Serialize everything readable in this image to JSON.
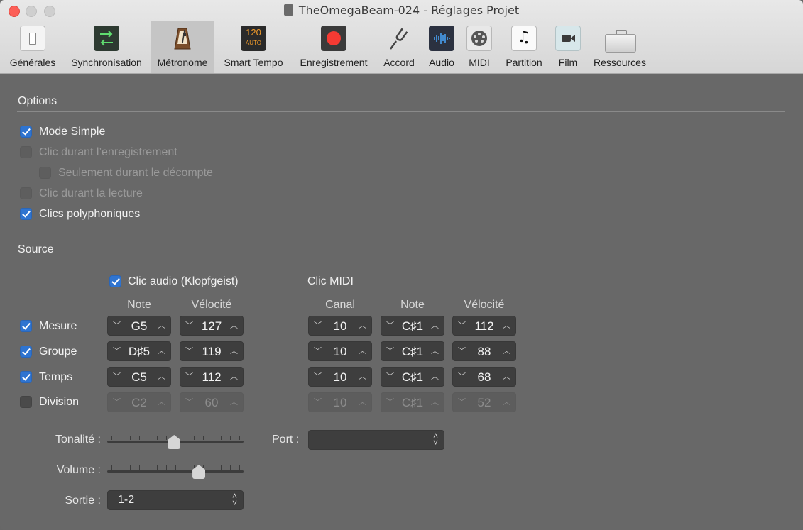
{
  "window": {
    "title": "TheOmegaBeam-024 - Réglages Projet"
  },
  "toolbar": {
    "items": [
      {
        "label": "Générales",
        "icon": "general-switch-icon"
      },
      {
        "label": "Synchronisation",
        "icon": "sync-arrows-icon"
      },
      {
        "label": "Métronome",
        "icon": "metronome-icon"
      },
      {
        "label": "Smart Tempo",
        "icon": "smart-tempo-icon",
        "icon_text": "120",
        "icon_sub": "AUTO"
      },
      {
        "label": "Enregistrement",
        "icon": "record-icon"
      },
      {
        "label": "Accord",
        "icon": "tuning-fork-icon"
      },
      {
        "label": "Audio",
        "icon": "audio-waveform-icon"
      },
      {
        "label": "MIDI",
        "icon": "midi-connector-icon"
      },
      {
        "label": "Partition",
        "icon": "score-note-icon"
      },
      {
        "label": "Film",
        "icon": "movie-camera-icon"
      },
      {
        "label": "Ressources",
        "icon": "briefcase-icon"
      }
    ],
    "selected": "Métronome"
  },
  "options": {
    "title": "Options",
    "items": [
      {
        "label": "Mode Simple",
        "checked": true,
        "enabled": true
      },
      {
        "label": "Clic durant l’enregistrement",
        "checked": false,
        "enabled": false
      },
      {
        "label": "Seulement durant le décompte",
        "checked": false,
        "enabled": false
      },
      {
        "label": "Clic durant la lecture",
        "checked": false,
        "enabled": false
      },
      {
        "label": "Clics polyphoniques",
        "checked": true,
        "enabled": true
      }
    ]
  },
  "source": {
    "title": "Source",
    "audio_click": {
      "label": "Clic audio (Klopfgeist)",
      "checked": true
    },
    "midi_click": {
      "label": "Clic MIDI"
    },
    "headers": {
      "audio_note": "Note",
      "audio_velocity": "Vélocité",
      "midi_channel": "Canal",
      "midi_note": "Note",
      "midi_velocity": "Vélocité"
    },
    "rows": [
      {
        "label": "Mesure",
        "checked": true,
        "audio_note": "G5",
        "audio_velocity": "127",
        "midi_channel": "10",
        "midi_note": "C♯1",
        "midi_velocity": "112"
      },
      {
        "label": "Groupe",
        "checked": true,
        "audio_note": "D♯5",
        "audio_velocity": "119",
        "midi_channel": "10",
        "midi_note": "C♯1",
        "midi_velocity": "88"
      },
      {
        "label": "Temps",
        "checked": true,
        "audio_note": "C5",
        "audio_velocity": "112",
        "midi_channel": "10",
        "midi_note": "C♯1",
        "midi_velocity": "68"
      },
      {
        "label": "Division",
        "checked": false,
        "audio_note": "C2",
        "audio_velocity": "60",
        "midi_channel": "10",
        "midi_note": "C♯1",
        "midi_velocity": "52"
      }
    ],
    "tonality": {
      "label": "Tonalité :",
      "level": 0.49
    },
    "volume": {
      "label": "Volume :",
      "level": 0.69
    },
    "output": {
      "label": "Sortie :",
      "value": "1-2"
    },
    "port": {
      "label": "Port :",
      "value": ""
    }
  },
  "colors": {
    "background": "#686868",
    "toolbar": "#dcdcdc",
    "accent": "#2f74d0",
    "control": "#3e3e3e"
  }
}
